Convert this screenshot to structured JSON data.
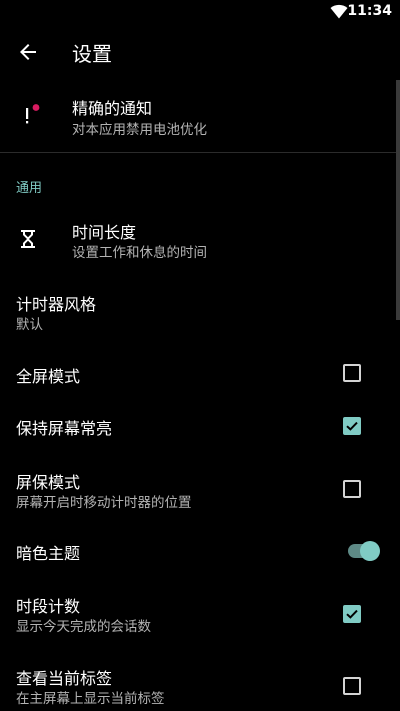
{
  "status_bar": {
    "time": "11:34",
    "wifi_icon": "wifi-icon"
  },
  "app_bar": {
    "title": "设置",
    "back_icon": "back-arrow-icon"
  },
  "notification_pref": {
    "title": "精确的通知",
    "summary": "对本应用禁用电池优化",
    "icon": "notification-alert-icon"
  },
  "category": {
    "label": "通用"
  },
  "preferences": {
    "duration": {
      "title": "时间长度",
      "summary": "设置工作和休息的时间",
      "icon": "hourglass-icon"
    },
    "timer_style": {
      "title": "计时器风格",
      "summary": "默认"
    },
    "fullscreen": {
      "title": "全屏模式",
      "checked": false
    },
    "keep_screen_on": {
      "title": "保持屏幕常亮",
      "checked": true
    },
    "screensaver": {
      "title": "屏保模式",
      "summary": "屏幕开启时移动计时器的位置",
      "checked": false
    },
    "dark_theme": {
      "title": "暗色主题",
      "enabled": true
    },
    "session_count": {
      "title": "时段计数",
      "summary": "显示今天完成的会话数",
      "checked": true
    },
    "current_label": {
      "title": "查看当前标签",
      "summary": "在主屏幕上显示当前标签",
      "checked": false
    }
  },
  "colors": {
    "accent": "#80cbc4",
    "background": "#000000",
    "secondary_text": "#b3b3b3"
  }
}
